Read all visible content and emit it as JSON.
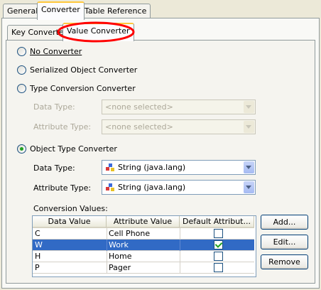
{
  "top_tabs": [
    "General",
    "Converter",
    "Table Reference"
  ],
  "sub_tabs": [
    "Key Converter",
    "Value Converter"
  ],
  "converters": {
    "no_converter": "No Converter",
    "serialized": "Serialized Object Converter",
    "type_conversion": "Type Conversion Converter",
    "object_type": "Object Type Converter"
  },
  "type_conversion_fields": {
    "data_type_label": "Data Type:",
    "data_type_value": "<none selected>",
    "attribute_type_label": "Attribute Type:",
    "attribute_type_value": "<none selected>"
  },
  "object_type_fields": {
    "data_type_label": "Data Type:",
    "data_type_value": "String (java.lang)",
    "attribute_type_label": "Attribute Type:",
    "attribute_type_value": "String (java.lang)"
  },
  "conversion": {
    "label": "Conversion Values:",
    "headers": [
      "Data Value",
      "Attribute Value",
      "Default Attribut..."
    ],
    "rows": [
      {
        "data": "C",
        "attr": "Cell Phone",
        "default": false
      },
      {
        "data": "W",
        "attr": "Work",
        "default": true
      },
      {
        "data": "H",
        "attr": "Home",
        "default": false
      },
      {
        "data": "P",
        "attr": "Pager",
        "default": false
      }
    ]
  },
  "buttons": {
    "add": "Add...",
    "edit": "Edit...",
    "remove": "Remove"
  },
  "colors": {
    "highlight_oval": "#ff0000",
    "selection": "#316ac5",
    "tab_accent": "#ffc83c"
  }
}
